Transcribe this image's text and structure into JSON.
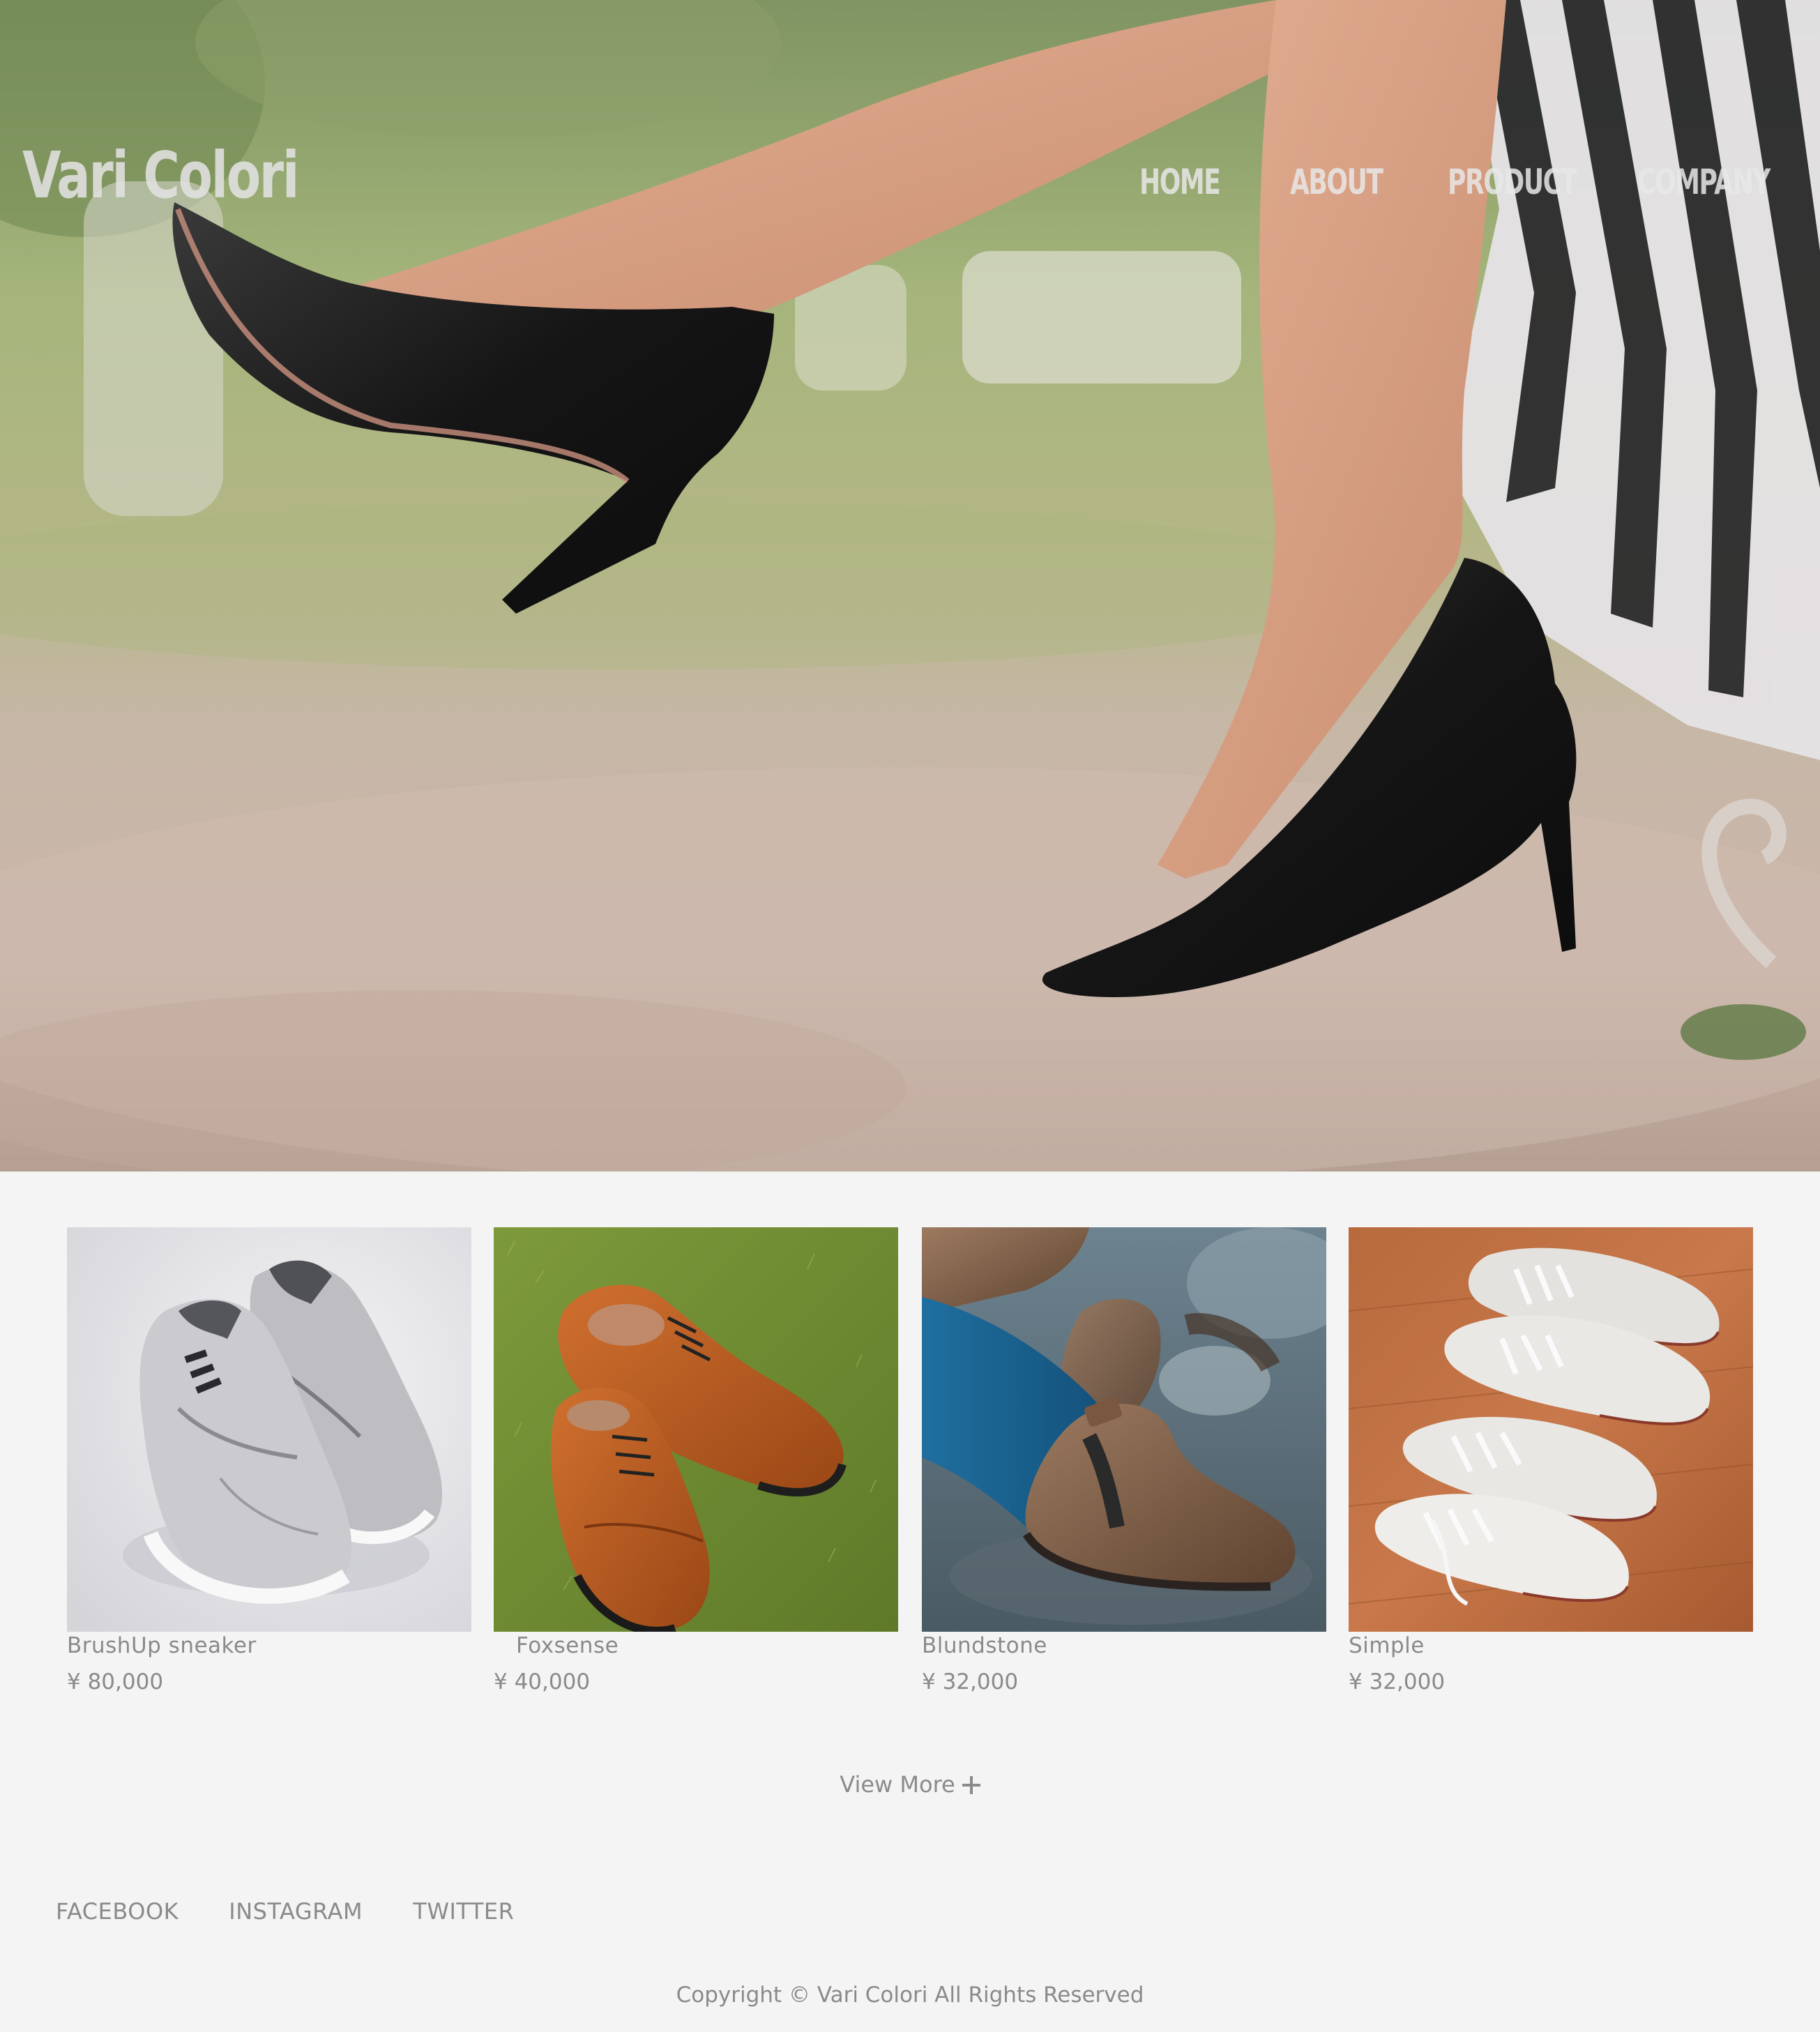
{
  "site": {
    "logo": "Vari Colori"
  },
  "nav": {
    "items": [
      {
        "label": "HOME"
      },
      {
        "label": "ABOUT"
      },
      {
        "label": "PRODUCT"
      },
      {
        "label": "COMPANY"
      }
    ]
  },
  "hero": {
    "image": "woman-legs-black-high-heels-photo"
  },
  "products": [
    {
      "name": "BrushUp sneaker",
      "price": "¥ 80,000",
      "image": "grey-sneakers-photo"
    },
    {
      "name": "Foxsense",
      "price": "¥ 40,000",
      "image": "brown-oxford-shoes-photo"
    },
    {
      "name": "Blundstone",
      "price": "¥ 32,000",
      "image": "brown-chelsea-boots-photo"
    },
    {
      "name": "Simple",
      "price": "¥ 32,000",
      "image": "white-canvas-sneakers-photo"
    }
  ],
  "view_more": {
    "label": "View More",
    "icon": "plus-icon"
  },
  "footer": {
    "social": [
      {
        "label": "FACEBOOK"
      },
      {
        "label": "INSTAGRAM"
      },
      {
        "label": "TWITTER"
      }
    ],
    "copyright": "Copyright © Vari Colori All Rights Reserved"
  },
  "colors": {
    "background": "#f4f4f4",
    "text": "#8a8a8a",
    "nav_text": "#e8e8e8"
  }
}
